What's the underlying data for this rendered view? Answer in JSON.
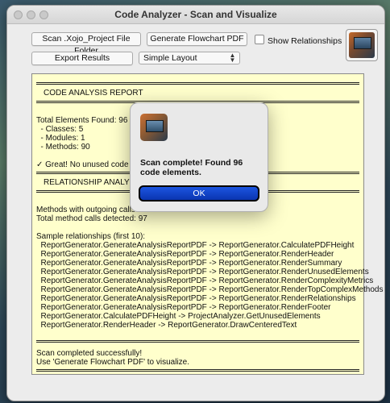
{
  "window": {
    "title": "Code Analyzer - Scan and Visualize"
  },
  "toolbar": {
    "scan_label": "Scan .Xojo_Project File Folder",
    "flowchart_label": "Generate Flowchart PDF",
    "show_relationships_label": "Show Relationships",
    "show_relationships_checked": false,
    "export_label": "Export Results",
    "layout_selected": "Simple Layout"
  },
  "report": {
    "header": "CODE ANALYSIS REPORT",
    "total": "Total Elements Found: 96",
    "classes": "  - Classes: 5",
    "modules": "  - Modules: 1",
    "methods": "  - Methods: 90",
    "unused": "✓ Great! No unused code",
    "rel_header": "RELATIONSHIP ANALYS",
    "outgoing": "Methods with outgoing calls",
    "total_calls": "Total method calls detected: 97",
    "sample_header": "Sample relationships (first 10):",
    "relationships": [
      "  ReportGenerator.GenerateAnalysisReportPDF -> ReportGenerator.CalculatePDFHeight",
      "  ReportGenerator.GenerateAnalysisReportPDF -> ReportGenerator.RenderHeader",
      "  ReportGenerator.GenerateAnalysisReportPDF -> ReportGenerator.RenderSummary",
      "  ReportGenerator.GenerateAnalysisReportPDF -> ReportGenerator.RenderUnusedElements",
      "  ReportGenerator.GenerateAnalysisReportPDF -> ReportGenerator.RenderComplexityMetrics",
      "  ReportGenerator.GenerateAnalysisReportPDF -> ReportGenerator.RenderTopComplexMethods",
      "  ReportGenerator.GenerateAnalysisReportPDF -> ReportGenerator.RenderRelationships",
      "  ReportGenerator.GenerateAnalysisReportPDF -> ReportGenerator.RenderFooter",
      "  ReportGenerator.CalculatePDFHeight -> ProjectAnalyzer.GetUnusedElements",
      "  ReportGenerator.RenderHeader -> ReportGenerator.DrawCenteredText"
    ],
    "completed": "Scan completed successfully!",
    "hint": "Use 'Generate Flowchart PDF' to visualize."
  },
  "dialog": {
    "message": "Scan complete! Found 96 code elements.",
    "ok_label": "OK"
  },
  "colors": {
    "report_bg": "#ffffcc",
    "ok_button": "#1c55e0"
  }
}
